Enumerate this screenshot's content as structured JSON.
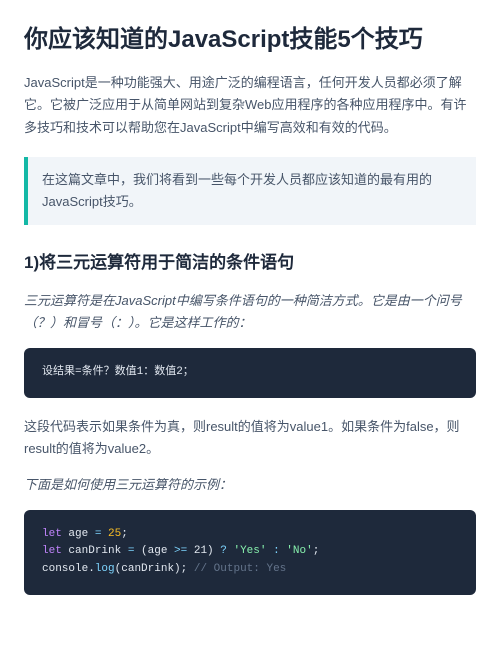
{
  "title": "你应该知道的JavaScript技能5个技巧",
  "intro": "JavaScript是一种功能强大、用途广泛的编程语言，任何开发人员都必须了解它。它被广泛应用于从简单网站到复杂Web应用程序的各种应用程序中。有许多技巧和技术可以帮助您在JavaScript中编写高效和有效的代码。",
  "callout": "在这篇文章中，我们将看到一些每个开发人员都应该知道的最有用的JavaScript技巧。",
  "section1": {
    "heading": "1)将三元运算符用于简洁的条件语句",
    "lead": "三元运算符是在JavaScript中编写条件语句的一种简洁方式。它是由一个问号（？）和冒号（：）。它是这样工作的：",
    "code1_plain": "设结果=条件？数值1：数值2；",
    "explain": "这段代码表示如果条件为真，则result的值将为value1。如果条件为false，则result的值将为value2。",
    "example_lead": "下面是如何使用三元运算符的示例：",
    "code2": {
      "line1_kw": "let",
      "line1_var": " age ",
      "line1_eq": "= ",
      "line1_num": "25",
      "line1_semi": ";",
      "line2_kw": "let",
      "line2_var": " canDrink ",
      "line2_eq": "= ",
      "line2_open": "(age ",
      "line2_op": ">=",
      "line2_val": " 21) ",
      "line2_q": "? ",
      "line2_yes": "'Yes'",
      "line2_colon": " : ",
      "line2_no": "'No'",
      "line2_semi": ";",
      "line3_obj": "console",
      "line3_dot": ".",
      "line3_fn": "log",
      "line3_open": "(canDrink); ",
      "line3_cmt": "// Output: Yes"
    }
  }
}
